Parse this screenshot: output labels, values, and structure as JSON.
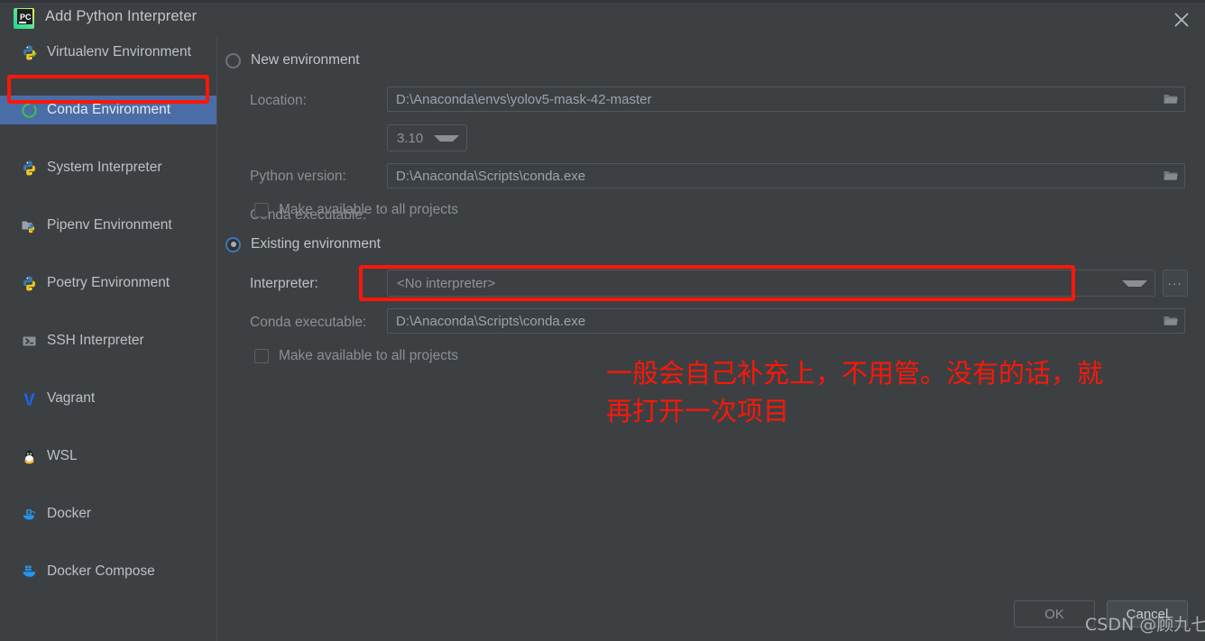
{
  "window": {
    "title": "Add Python Interpreter",
    "app_icon": "pycharm-icon",
    "close_icon": "close-icon"
  },
  "sidebar": {
    "items": [
      {
        "label": "Virtualenv Environment",
        "icon": "python-virtualenv-icon",
        "selected": false
      },
      {
        "label": "Conda Environment",
        "icon": "conda-icon",
        "selected": true
      },
      {
        "label": "System Interpreter",
        "icon": "python-icon",
        "selected": false
      },
      {
        "label": "Pipenv Environment",
        "icon": "pipenv-icon",
        "selected": false
      },
      {
        "label": "Poetry Environment",
        "icon": "poetry-icon",
        "selected": false
      },
      {
        "label": "SSH Interpreter",
        "icon": "ssh-terminal-icon",
        "selected": false
      },
      {
        "label": "Vagrant",
        "icon": "vagrant-icon",
        "selected": false
      },
      {
        "label": "WSL",
        "icon": "linux-penguin-icon",
        "selected": false
      },
      {
        "label": "Docker",
        "icon": "docker-icon",
        "selected": false
      },
      {
        "label": "Docker Compose",
        "icon": "docker-compose-icon",
        "selected": false
      }
    ]
  },
  "main": {
    "new_environment": {
      "radio_label": "New environment",
      "selected": false,
      "location": {
        "label": "Location:",
        "value": "D:\\Anaconda\\envs\\yolov5-mask-42-master",
        "browse_icon": "folder-icon"
      },
      "python_version": {
        "label": "Python version:",
        "value": "3.10",
        "dropdown_icon": "chevron-down-icon"
      },
      "conda_executable": {
        "label": "Conda executable:",
        "value": "D:\\Anaconda\\Scripts\\conda.exe",
        "browse_icon": "folder-icon"
      },
      "make_available": {
        "label": "Make available to all projects",
        "checked": false
      }
    },
    "existing_environment": {
      "radio_label": "Existing environment",
      "selected": true,
      "interpreter": {
        "label": "Interpreter:",
        "value": "<No interpreter>",
        "dropdown_icon": "chevron-down-icon",
        "more_button_label": "..."
      },
      "conda_executable": {
        "label": "Conda executable:",
        "value": "D:\\Anaconda\\Scripts\\conda.exe",
        "browse_icon": "folder-icon"
      },
      "make_available": {
        "label": "Make available to all projects",
        "checked": false
      }
    }
  },
  "annotation": {
    "text": "一般会自己补充上，不用管。没有的话，就\n再打开一次项目",
    "color": "#fc1708"
  },
  "footer": {
    "ok_label": "OK",
    "cancel_label": "Cancel",
    "watermark": "CSDN @顾九七"
  },
  "colors": {
    "background": "#3c4043",
    "selection_blue": "#4a6da7",
    "annotation_red": "#fc1708",
    "radio_accent": "#3d77b5"
  }
}
